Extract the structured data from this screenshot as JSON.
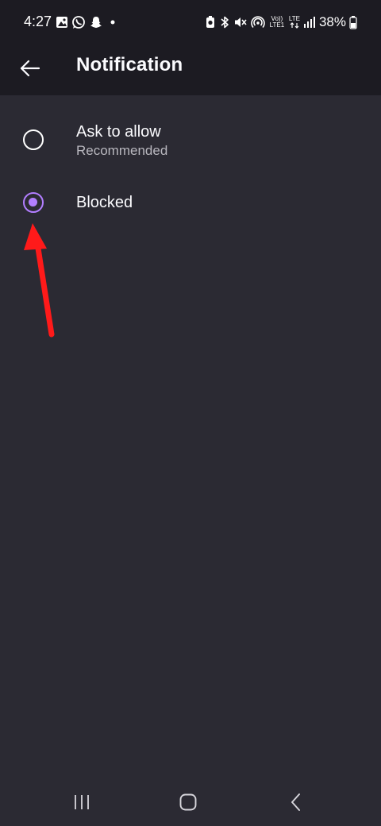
{
  "status_bar": {
    "time": "4:27",
    "left_icons": [
      "gallery-icon",
      "whatsapp-icon",
      "snapchat-icon",
      "dot-icon"
    ],
    "right_icons": [
      "battery-saver-icon",
      "bluetooth-icon",
      "mute-icon",
      "hotspot-icon",
      "volte-icon",
      "lte-icon",
      "signal-icon"
    ],
    "volte_text": "Vo)) LTE1",
    "lte_text": "LTE",
    "battery_text": "38%"
  },
  "app_bar": {
    "back_icon": "arrow-left-icon",
    "title": "Notification"
  },
  "options": [
    {
      "label": "Ask to allow",
      "sublabel": "Recommended",
      "selected": false
    },
    {
      "label": "Blocked",
      "sublabel": "",
      "selected": true
    }
  ],
  "nav_bar": {
    "icons": [
      "recents-icon",
      "home-icon",
      "back-icon"
    ]
  },
  "colors": {
    "background": "#2b2a33",
    "bar": "#1c1b22",
    "accent": "#b27eff",
    "annotation": "#ff1a1a"
  }
}
